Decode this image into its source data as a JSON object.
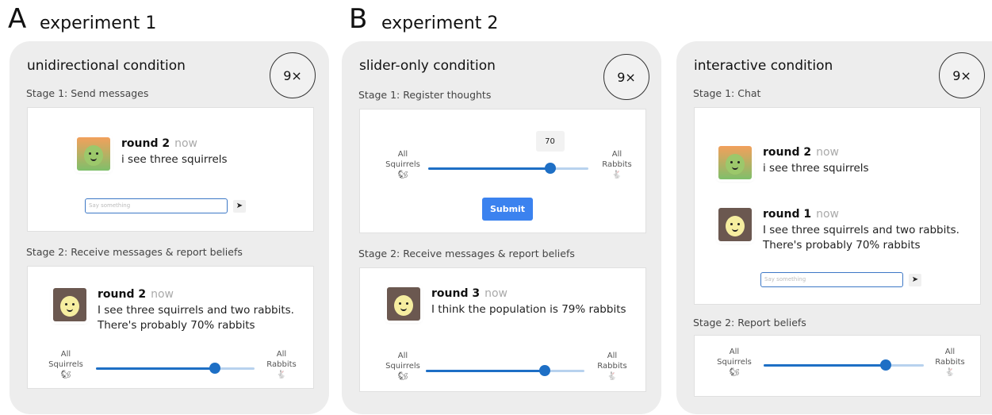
{
  "section_a": {
    "letter": "A",
    "title": "experiment 1"
  },
  "section_b": {
    "letter": "B",
    "title": "experiment 2"
  },
  "panels": [
    {
      "title": "unidirectional condition",
      "badge": "9×",
      "stage1": {
        "label": "Stage 1: Send messages",
        "message": {
          "round": "round 2",
          "time": "now",
          "text": "i see three squirrels"
        },
        "input_placeholder": "Say something",
        "send_icon": "send-icon"
      },
      "stage2": {
        "label": "Stage 2: Receive messages & report beliefs",
        "message": {
          "round": "round 2",
          "time": "now",
          "line1": "I see three squirrels and two rabbits.",
          "line2": "There's probably 70% rabbits"
        },
        "slider": {
          "left_top": "All",
          "left_bottom": "Squirrels",
          "right_top": "All",
          "right_bottom": "Rabbits",
          "value_pct": 75
        }
      }
    },
    {
      "title": "slider-only condition",
      "badge": "9×",
      "stage1": {
        "label": "Stage 1: Register thoughts",
        "slider": {
          "left_top": "All",
          "left_bottom": "Squirrels",
          "right_top": "All",
          "right_bottom": "Rabbits",
          "value": "70",
          "value_pct": 76
        },
        "submit_label": "Submit"
      },
      "stage2": {
        "label": "Stage 2: Receive messages & report beliefs",
        "message": {
          "round": "round 3",
          "time": "now",
          "text": "I think the population is 79% rabbits"
        },
        "slider": {
          "left_top": "All",
          "left_bottom": "Squirrels",
          "right_top": "All",
          "right_bottom": "Rabbits",
          "value_pct": 75
        }
      }
    },
    {
      "title": "interactive condition",
      "badge": "9×",
      "stage1": {
        "label": "Stage 1: Chat",
        "message1": {
          "round": "round 2",
          "time": "now",
          "text": "i see three squirrels"
        },
        "message2": {
          "round": "round 1",
          "time": "now",
          "line1": "I see three squirrels and two rabbits.",
          "line2": "There's probably 70% rabbits"
        },
        "input_placeholder": "Say something"
      },
      "stage2": {
        "label": "Stage 2: Report beliefs",
        "slider": {
          "left_top": "All",
          "left_bottom": "Squirrels",
          "right_top": "All",
          "right_bottom": "Rabbits",
          "value_pct": 76
        }
      }
    }
  ],
  "icons": {
    "squirrel": "🐿",
    "rabbit": "🐇",
    "send": "➤"
  }
}
